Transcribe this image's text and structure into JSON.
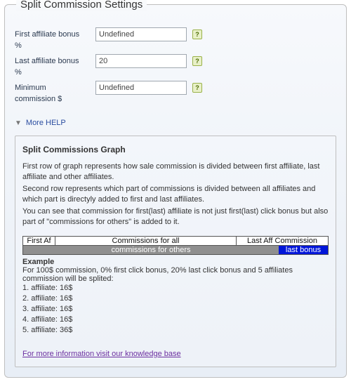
{
  "panel_title": "Split Commission Settings",
  "fields": {
    "first_bonus": {
      "label": "First affiliate bonus",
      "value": "Undefined",
      "unit": "%"
    },
    "last_bonus": {
      "label": "Last affiliate bonus",
      "value": "20",
      "unit": "%"
    },
    "min_comm": {
      "label": "Minimum commission $",
      "value": "Undefined",
      "unit": ""
    }
  },
  "help_icon_char": "?",
  "more_help": "More HELP",
  "graph": {
    "heading": "Split Commissions Graph",
    "desc1": "First row of graph represents how sale commission is divided between first affiliate, last affiliate and other affiliates.",
    "desc2": "Second row represents which part of commissions is divided between all affiliates and which part is directyly added to first and last affiliates.",
    "desc3": "You can see that commission for first(last) affiliate is not just first(last) click bonus but also part of \"commissions for others\" is added to it.",
    "row1": {
      "c1": "First Af",
      "c2": "Commissions for all",
      "c3": "Last Aff Commission"
    },
    "row2": {
      "c1": "commissions for others",
      "c2": "last bonus"
    },
    "example_title": "Example",
    "example_intro": "For 100$ commission, 0% first click bonus, 20% last click bonus and 5 affiliates commission will be splited:",
    "example_rows": [
      "1. affiliate: 16$",
      "2. affiliate: 16$",
      "3. affiliate: 16$",
      "4. affiliate: 16$",
      "5. affiliate: 36$"
    ],
    "kb_link": "For more information visit our knowledge base"
  }
}
